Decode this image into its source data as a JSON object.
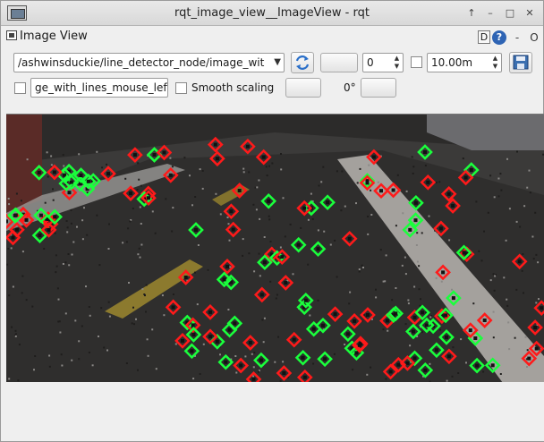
{
  "window": {
    "title": "rqt_image_view__ImageView - rqt",
    "controls": [
      "↑",
      "–",
      "□",
      "✕"
    ]
  },
  "dock": {
    "title": "Image View",
    "d_label": "D",
    "help_label": "?",
    "close_label": "-",
    "float_label": "O"
  },
  "toolbar": {
    "topic_value": "/ashwinsduckie/line_detector_node/image_wit",
    "width_value": "",
    "spin_value": "0",
    "range_value": "10.00m",
    "click_topic_value": "ge_with_lines_mouse_left",
    "smooth_scaling_label": "Smooth scaling",
    "rotate_label": "0°"
  },
  "image": {
    "content": "line detector overlay with red and green segment markers"
  },
  "colors": {
    "marker_red": "#ff1a1a",
    "marker_green": "#1aff3c"
  }
}
